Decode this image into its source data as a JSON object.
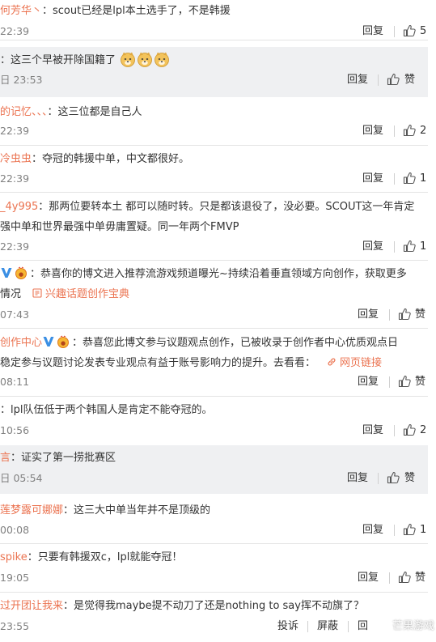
{
  "icons": {
    "thumb": "thumbs-up-icon",
    "link": "link-icon",
    "verified": "verified-v-icon",
    "medal": "creator-medal-icon",
    "emoji": "doge-emoji-icon"
  },
  "colors": {
    "username": "#eb7350",
    "highlight_bg": "#eff0f2",
    "time": "#808080"
  },
  "comments": [
    {
      "user": "何芳华丶",
      "text": "：scout已经是lpl本土选手了，不是韩援",
      "time": "22:39",
      "reply": "回复",
      "like": "5"
    },
    {
      "user": "",
      "text": "：这三个早被开除国籍了",
      "time": "日 23:53",
      "reply": "回复",
      "like": "赞"
    },
    {
      "user": "的记忆、、、",
      "text": "：这三位都是自己人",
      "time": "22:39",
      "reply": "回复",
      "like": "2"
    },
    {
      "user": "冷虫虫",
      "text": "：夺冠的韩援中单，中文都很好。",
      "time": "22:39",
      "reply": "回复",
      "like": "1"
    },
    {
      "user": "_4y995",
      "text": "：那两位要转本土 都可以随时转。只是都该退役了，没必要。SCOUT这一年肯定",
      "text2": "强中单和世界最强中单毋庸置疑。同一年两个FMVP",
      "time": "22:39",
      "reply": "回复",
      "like": "1"
    },
    {
      "user": "",
      "text": "：恭喜你的博文进入推荐流游戏频道曝光~持续沿着垂直领域方向创作，获取更多",
      "text2": "情况",
      "link": "兴趣话题创作宝典",
      "time": "07:43",
      "reply": "回复",
      "like": "赞"
    },
    {
      "user": "创作中心",
      "text": "：恭喜您此博文参与议题观点创作，已被收录于创作者中心优质观点日",
      "text2": "稳定参与议题讨论发表专业观点有益于账号影响力的提升。去看看：",
      "link": "网页链接",
      "time": "08:11",
      "reply": "回复",
      "like": "赞"
    },
    {
      "user": "",
      "text": "：lpl队伍低于两个韩国人是肯定不能夺冠的。",
      "time": "10:56",
      "reply": "回复",
      "like": "2"
    },
    {
      "user": "言",
      "text": "：证实了第一捞批赛区",
      "time": "日 05:54",
      "reply": "回复",
      "like": "赞"
    },
    {
      "user": "莲梦露可娜娜",
      "text": "：这三大中单当年并不是顶级的",
      "time": "00:08",
      "reply": "回复",
      "like": "1"
    },
    {
      "user": "spike",
      "text": "：只要有韩援双c，lpl就能夺冠！",
      "time": "19:05",
      "reply": "回复",
      "like": "赞"
    },
    {
      "user": "过开团让我来",
      "text": "：是觉得我maybe提不动刀了还是nothing to say挥不动旗了？",
      "time": "23:55",
      "report": "投诉",
      "block": "屏蔽",
      "reply": "回"
    }
  ],
  "watermark": "芒果游戏"
}
